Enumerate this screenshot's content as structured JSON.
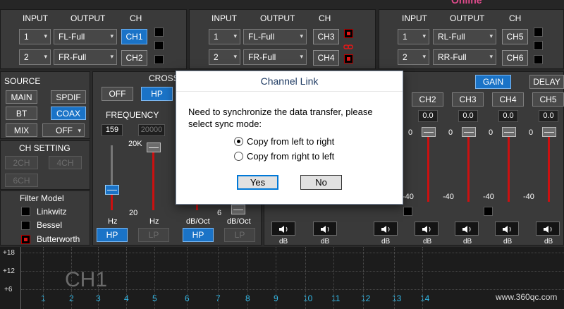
{
  "top_banner": {
    "text": "Online"
  },
  "routing": {
    "headers": {
      "input": "INPUT",
      "output": "OUTPUT",
      "ch": "CH"
    },
    "groups": [
      {
        "rows": [
          {
            "input": "1",
            "output": "FL-Full",
            "ch": "CH1",
            "ch_active": true
          },
          {
            "input": "2",
            "output": "FR-Full",
            "ch": "CH2",
            "ch_active": false
          }
        ]
      },
      {
        "rows": [
          {
            "input": "1",
            "output": "FL-Full",
            "ch": "CH3",
            "ch_active": false
          },
          {
            "input": "2",
            "output": "FR-Full",
            "ch": "CH4",
            "ch_active": false
          }
        ]
      },
      {
        "rows": [
          {
            "input": "1",
            "output": "RL-Full",
            "ch": "CH5",
            "ch_active": false
          },
          {
            "input": "2",
            "output": "RR-Full",
            "ch": "CH6",
            "ch_active": false
          }
        ]
      }
    ]
  },
  "source": {
    "title": "SOURCE",
    "buttons": {
      "main": "MAIN",
      "spdif": "SPDIF",
      "bt": "BT",
      "coax": "COAX"
    },
    "active": "COAX",
    "mix_label": "MIX",
    "mix_value": "OFF"
  },
  "ch_setting": {
    "title": "CH SETTING",
    "buttons": [
      "2CH",
      "4CH",
      "6CH"
    ]
  },
  "filter_model": {
    "title": "Filter Model",
    "options": [
      "Linkwitz",
      "Bessel",
      "Butterworth"
    ],
    "selected": "Butterworth"
  },
  "crossover": {
    "title": "CROSS",
    "off_label": "OFF",
    "hp_label": "HP",
    "frequency_label": "FREQUENCY",
    "hp_freq": "159",
    "lp_freq": "20000",
    "scale_top": "20K",
    "scale_bottom": "20",
    "oct_scale_bottom": "6",
    "hz_label": "Hz",
    "dboct_label": "dB/Oct",
    "hp_button": "HP",
    "lp_button": "LP"
  },
  "gain_panel": {
    "gain_tab": "GAIN",
    "delay_tab": "DELAY",
    "channels": [
      "CH2",
      "CH3",
      "CH4",
      "CH5"
    ],
    "values": [
      "0.0",
      "0.0",
      "0.0",
      "0.0",
      "0.0"
    ],
    "scale_top": "0",
    "scale_bottom": "-40",
    "db_label": "dB"
  },
  "dialog": {
    "title": "Channel Link",
    "message": "Need to synchronize the data transfer, please select sync mode:",
    "options": [
      "Copy from left to right",
      "Copy from right to left"
    ],
    "selected_option": 0,
    "yes": "Yes",
    "no": "No"
  },
  "eq_graph": {
    "y_labels": [
      "+18",
      "+12",
      "+6"
    ],
    "channel_label": "CH1",
    "band_numbers": [
      "1",
      "2",
      "3",
      "4",
      "5",
      "6",
      "7",
      "8",
      "9",
      "10",
      "11",
      "12",
      "13",
      "14"
    ]
  },
  "watermark": {
    "text": "www.360qc.com"
  }
}
